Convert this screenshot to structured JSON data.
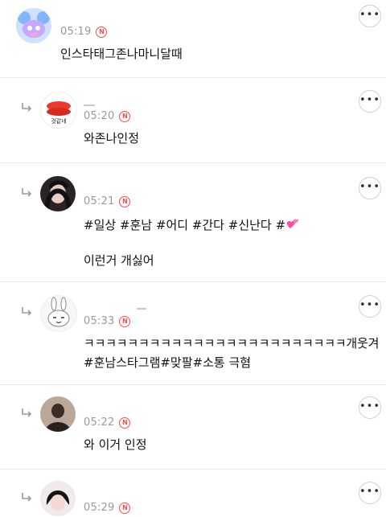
{
  "comments": [
    {
      "time": "05:19",
      "badge": "N",
      "text": "인스타태그존나마니달때"
    },
    {
      "time": "05:20",
      "badge": "N",
      "text": "와존나인정",
      "avatar_text": "것같네"
    },
    {
      "time": "05:21",
      "badge": "N",
      "text": "#일상 #훈남 #어디 #간다 #신난다 #",
      "text2": "이런거 개싫어"
    },
    {
      "time": "05:33",
      "badge": "N",
      "text": "ㅋㅋㅋㅋㅋㅋㅋㅋㅋㅋㅋㅋㅋㅋㅋㅋㅋㅋㅋㅋㅋㅋㅋㅋ개웃겨",
      "text2": "#훈남스타그램#맞팔#소통 극혐"
    },
    {
      "time": "05:22",
      "badge": "N",
      "text": "와 이거 인정"
    },
    {
      "time": "05:29",
      "badge": "N"
    }
  ],
  "more_icon": "more-horizontal-icon",
  "reply_icon": "reply-arrow-icon",
  "colors": {
    "badge": "#ff4b4b",
    "time": "#9a9a9a",
    "divider": "#e9e9e9",
    "heart": "#ff4fa3"
  }
}
